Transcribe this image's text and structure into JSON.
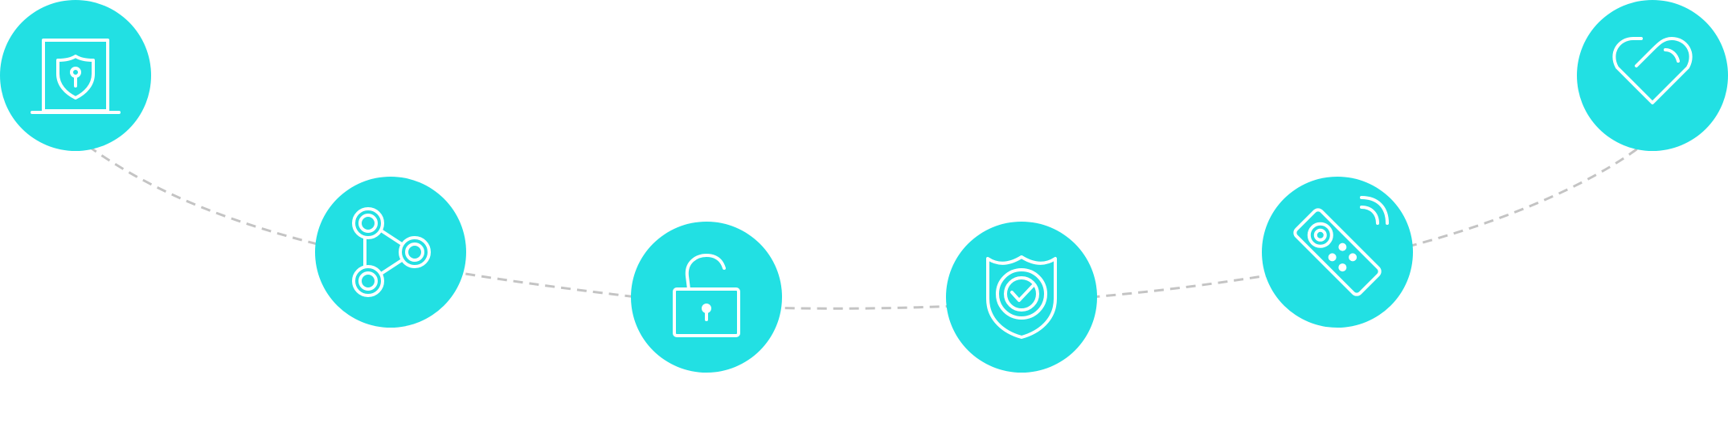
{
  "colors": {
    "node_fill": "#22e0e3",
    "icon_stroke": "#ffffff",
    "connector": "#c4c4c4",
    "background": "#ffffff"
  },
  "nodes": [
    {
      "icon": "shield-laptop-icon",
      "label": ""
    },
    {
      "icon": "molecule-icon",
      "label": ""
    },
    {
      "icon": "unlocked-padlock-icon",
      "label": ""
    },
    {
      "icon": "shield-check-icon",
      "label": ""
    },
    {
      "icon": "remote-control-icon",
      "label": ""
    },
    {
      "icon": "heart-link-icon",
      "label": ""
    }
  ]
}
